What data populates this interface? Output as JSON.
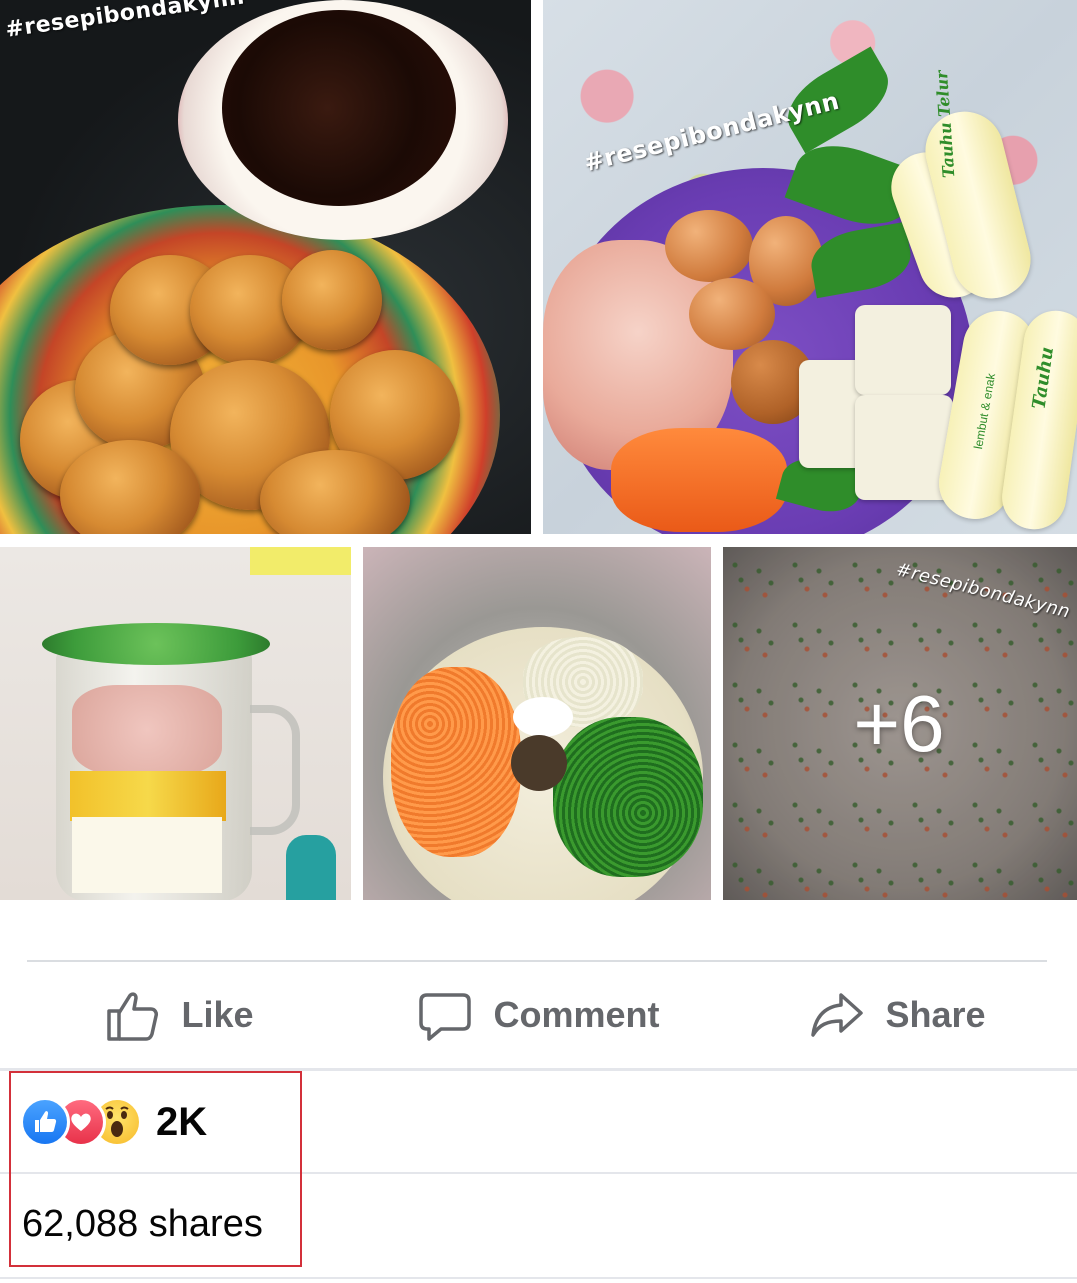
{
  "post": {
    "photos": [
      {
        "watermark": "#resepibondakynn",
        "alt": "fried vegetable cakes with dip"
      },
      {
        "watermark": "#resepibondakynn",
        "alt": "raw ingredients"
      },
      {
        "watermark": "",
        "alt": "blender"
      },
      {
        "watermark": "",
        "alt": "mixing bowl"
      },
      {
        "watermark": "#resepibondakynn",
        "alt": "batter",
        "more_count": "+6"
      }
    ],
    "packaging": {
      "brand_1": "Tauhu Telur",
      "sub_1": "lembut & enak",
      "brand_2": "Tauhu"
    }
  },
  "actions": {
    "like": "Like",
    "comment": "Comment",
    "share": "Share"
  },
  "reactions": {
    "types": [
      "like",
      "love",
      "wow"
    ],
    "count": "2K"
  },
  "shares": {
    "label": "62,088 shares"
  },
  "colors": {
    "action_gray": "#65676b",
    "highlight": "#d3303a",
    "like_blue": "#1877f2"
  }
}
